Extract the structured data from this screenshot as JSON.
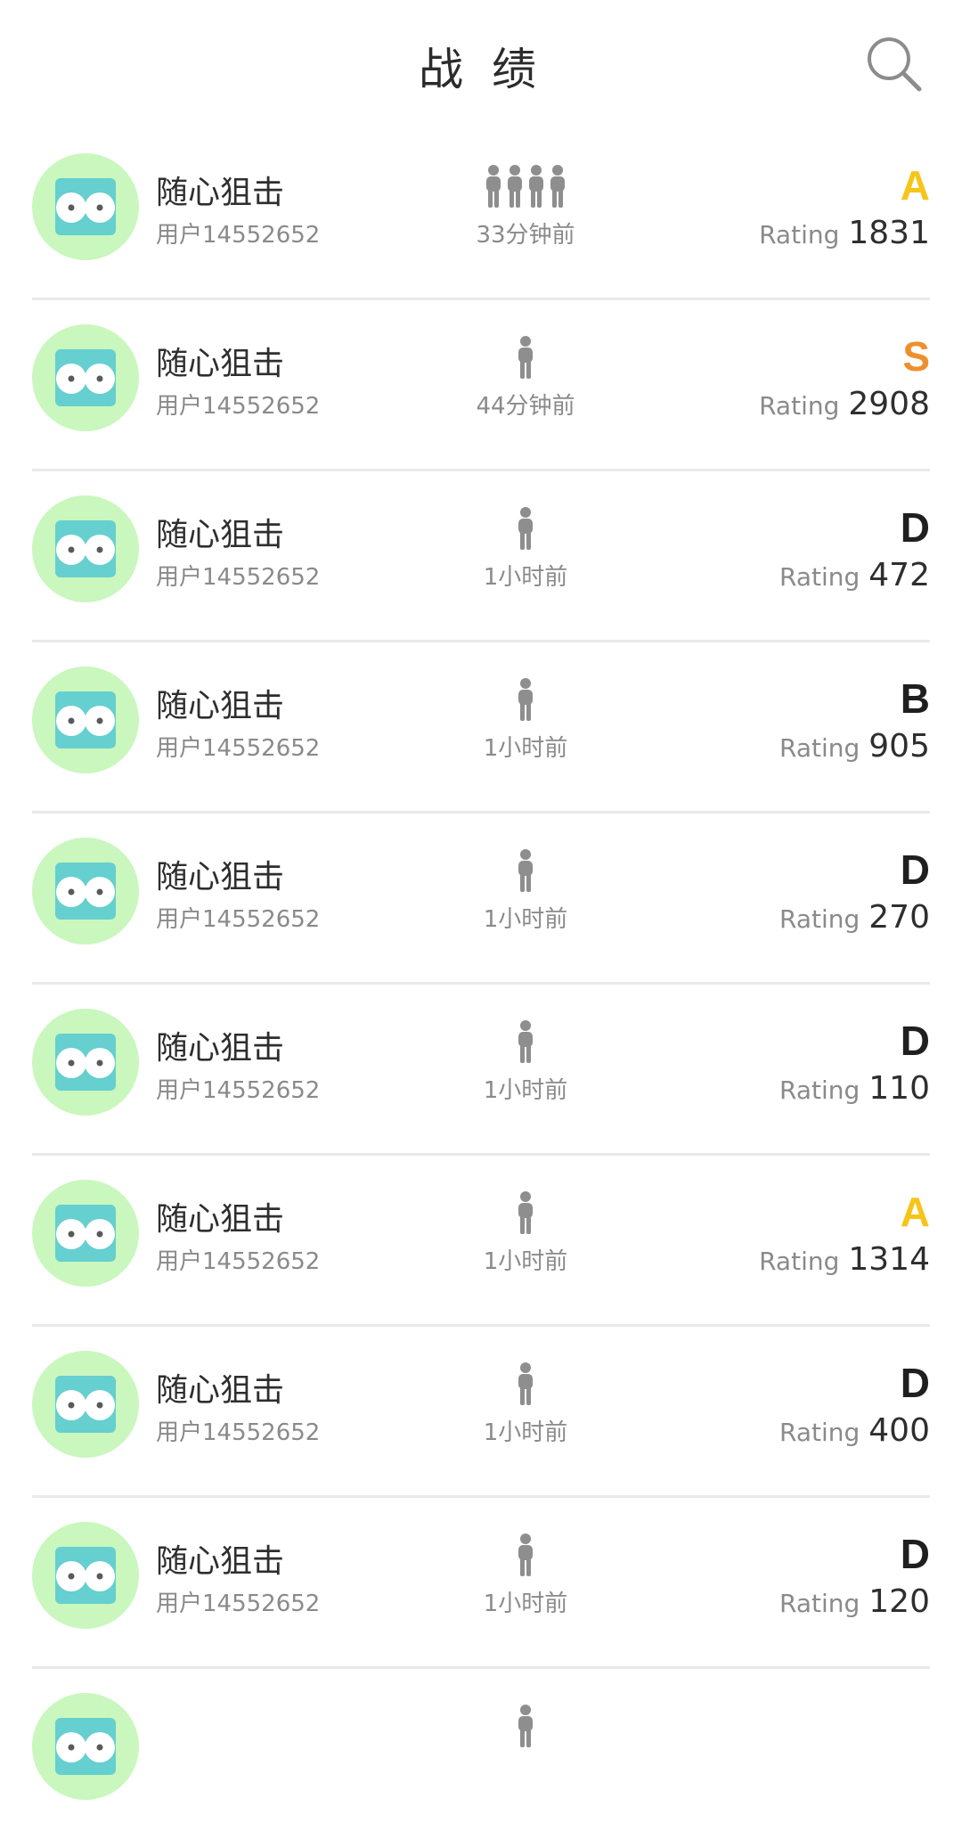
{
  "header": {
    "title": "战 绩"
  },
  "icons": {
    "search": "search-icon",
    "avatar": "avatar-owl-icon",
    "player": "person-icon"
  },
  "colors": {
    "grade_S": "#ef8f2b",
    "grade_A": "#f5c518",
    "grade_default": "#1f1f1f",
    "avatar_bg": "#c9f7bd",
    "avatar_face": "#66cfcf"
  },
  "rating_label": "Rating",
  "matches": [
    {
      "name": "随心狙击",
      "uid": "用户14552652",
      "players": 4,
      "time": "33分钟前",
      "grade": "A",
      "rating": "1831"
    },
    {
      "name": "随心狙击",
      "uid": "用户14552652",
      "players": 1,
      "time": "44分钟前",
      "grade": "S",
      "rating": "2908"
    },
    {
      "name": "随心狙击",
      "uid": "用户14552652",
      "players": 1,
      "time": "1小时前",
      "grade": "D",
      "rating": "472"
    },
    {
      "name": "随心狙击",
      "uid": "用户14552652",
      "players": 1,
      "time": "1小时前",
      "grade": "B",
      "rating": "905"
    },
    {
      "name": "随心狙击",
      "uid": "用户14552652",
      "players": 1,
      "time": "1小时前",
      "grade": "D",
      "rating": "270"
    },
    {
      "name": "随心狙击",
      "uid": "用户14552652",
      "players": 1,
      "time": "1小时前",
      "grade": "D",
      "rating": "110"
    },
    {
      "name": "随心狙击",
      "uid": "用户14552652",
      "players": 1,
      "time": "1小时前",
      "grade": "A",
      "rating": "1314"
    },
    {
      "name": "随心狙击",
      "uid": "用户14552652",
      "players": 1,
      "time": "1小时前",
      "grade": "D",
      "rating": "400"
    },
    {
      "name": "随心狙击",
      "uid": "用户14552652",
      "players": 1,
      "time": "1小时前",
      "grade": "D",
      "rating": "120"
    }
  ]
}
